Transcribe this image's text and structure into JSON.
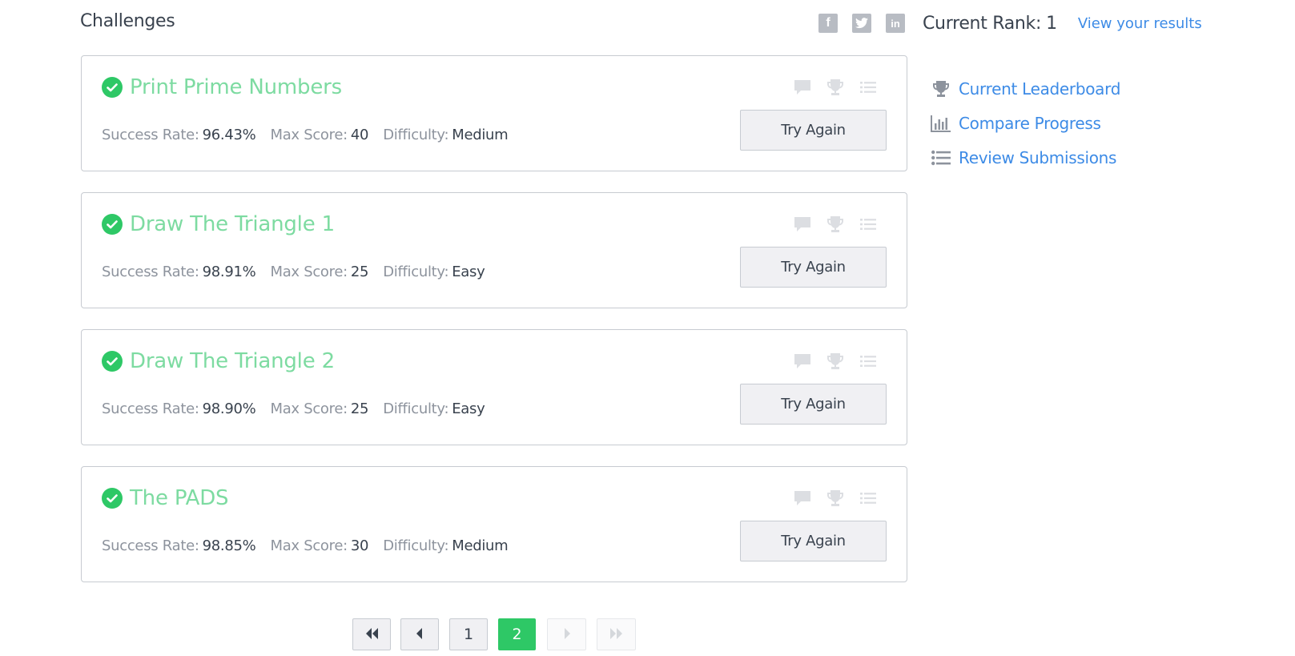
{
  "page": {
    "title": "Challenges"
  },
  "header": {
    "social": [
      {
        "name": "facebook",
        "icon": "facebook-icon",
        "glyph": "f"
      },
      {
        "name": "twitter",
        "icon": "twitter-icon",
        "glyph": ""
      },
      {
        "name": "linkedin",
        "icon": "linkedin-icon",
        "glyph": "in"
      }
    ],
    "rank_label": "Current Rank:",
    "rank_value": "1",
    "view_results": "View your results"
  },
  "challenges": [
    {
      "title": "Print Prime Numbers",
      "success_label": "Success Rate:",
      "success_rate": "96.43%",
      "score_label": "Max Score:",
      "max_score": "40",
      "difficulty_label": "Difficulty:",
      "difficulty": "Medium",
      "button": "Try Again"
    },
    {
      "title": "Draw The Triangle 1",
      "success_label": "Success Rate:",
      "success_rate": "98.91%",
      "score_label": "Max Score:",
      "max_score": "25",
      "difficulty_label": "Difficulty:",
      "difficulty": "Easy",
      "button": "Try Again"
    },
    {
      "title": "Draw The Triangle 2",
      "success_label": "Success Rate:",
      "success_rate": "98.90%",
      "score_label": "Max Score:",
      "max_score": "25",
      "difficulty_label": "Difficulty:",
      "difficulty": "Easy",
      "button": "Try Again"
    },
    {
      "title": "The PADS",
      "success_label": "Success Rate:",
      "success_rate": "98.85%",
      "score_label": "Max Score:",
      "max_score": "30",
      "difficulty_label": "Difficulty:",
      "difficulty": "Medium",
      "button": "Try Again"
    }
  ],
  "sidebar": {
    "links": [
      {
        "label": "Current Leaderboard",
        "icon": "trophy-icon"
      },
      {
        "label": "Compare Progress",
        "icon": "bar-chart-icon"
      },
      {
        "label": "Review Submissions",
        "icon": "list-icon"
      }
    ]
  },
  "pagination": {
    "first_icon": "double-chevron-left-icon",
    "prev_icon": "chevron-left-icon",
    "next_icon": "chevron-right-icon",
    "last_icon": "double-chevron-right-icon",
    "pages": [
      "1",
      "2"
    ],
    "current_page": "2"
  },
  "colors": {
    "accent_green": "#2ec866",
    "title_green": "#7ddba1",
    "link_blue": "#3d8be6",
    "text_dark": "#39424e",
    "text_muted": "#8d939d"
  }
}
